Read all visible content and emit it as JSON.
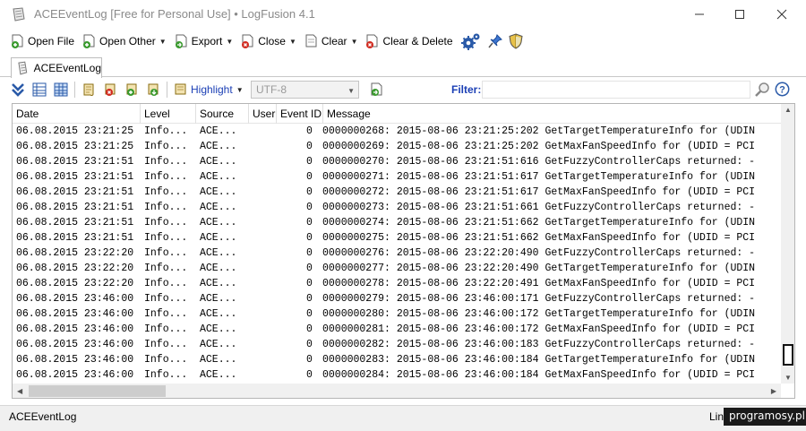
{
  "window": {
    "title": "ACEEventLog [Free for Personal Use] • LogFusion 4.1"
  },
  "toolbar": {
    "open_file": "Open File",
    "open_other": "Open Other",
    "export": "Export",
    "close": "Close",
    "clear": "Clear",
    "clear_delete": "Clear & Delete"
  },
  "tab": {
    "label": "ACEEventLog"
  },
  "toolbar2": {
    "highlight": "Highlight",
    "encoding": "UTF-8",
    "filter_label": "Filter:",
    "filter_value": ""
  },
  "grid": {
    "columns": [
      "Date",
      "Level",
      "Source",
      "User",
      "Event ID",
      "Message"
    ],
    "rows": [
      [
        "06.08.2015 23:21:25",
        "Info...",
        "ACE...",
        "",
        "0",
        "0000000268: 2015-08-06 23:21:25:202     GetTargetTemperatureInfo for (UDIN"
      ],
      [
        "06.08.2015 23:21:25",
        "Info...",
        "ACE...",
        "",
        "0",
        "0000000269: 2015-08-06 23:21:25:202     GetMaxFanSpeedInfo for (UDID = PCI"
      ],
      [
        "06.08.2015 23:21:51",
        "Info...",
        "ACE...",
        "",
        "0",
        "0000000270: 2015-08-06 23:21:51:616     GetFuzzyControllerCaps returned: -"
      ],
      [
        "06.08.2015 23:21:51",
        "Info...",
        "ACE...",
        "",
        "0",
        "0000000271: 2015-08-06 23:21:51:617     GetTargetTemperatureInfo for (UDIN"
      ],
      [
        "06.08.2015 23:21:51",
        "Info...",
        "ACE...",
        "",
        "0",
        "0000000272: 2015-08-06 23:21:51:617     GetMaxFanSpeedInfo for (UDID = PCI"
      ],
      [
        "06.08.2015 23:21:51",
        "Info...",
        "ACE...",
        "",
        "0",
        "0000000273: 2015-08-06 23:21:51:661     GetFuzzyControllerCaps returned: -"
      ],
      [
        "06.08.2015 23:21:51",
        "Info...",
        "ACE...",
        "",
        "0",
        "0000000274: 2015-08-06 23:21:51:662     GetTargetTemperatureInfo for (UDIN"
      ],
      [
        "06.08.2015 23:21:51",
        "Info...",
        "ACE...",
        "",
        "0",
        "0000000275: 2015-08-06 23:21:51:662     GetMaxFanSpeedInfo for (UDID = PCI"
      ],
      [
        "06.08.2015 23:22:20",
        "Info...",
        "ACE...",
        "",
        "0",
        "0000000276: 2015-08-06 23:22:20:490     GetFuzzyControllerCaps returned: -"
      ],
      [
        "06.08.2015 23:22:20",
        "Info...",
        "ACE...",
        "",
        "0",
        "0000000277: 2015-08-06 23:22:20:490     GetTargetTemperatureInfo for (UDIN"
      ],
      [
        "06.08.2015 23:22:20",
        "Info...",
        "ACE...",
        "",
        "0",
        "0000000278: 2015-08-06 23:22:20:491     GetMaxFanSpeedInfo for (UDID = PCI"
      ],
      [
        "06.08.2015 23:46:00",
        "Info...",
        "ACE...",
        "",
        "0",
        "0000000279: 2015-08-06 23:46:00:171     GetFuzzyControllerCaps returned: -"
      ],
      [
        "06.08.2015 23:46:00",
        "Info...",
        "ACE...",
        "",
        "0",
        "0000000280: 2015-08-06 23:46:00:172     GetTargetTemperatureInfo for (UDIN"
      ],
      [
        "06.08.2015 23:46:00",
        "Info...",
        "ACE...",
        "",
        "0",
        "0000000281: 2015-08-06 23:46:00:172     GetMaxFanSpeedInfo for (UDID = PCI"
      ],
      [
        "06.08.2015 23:46:00",
        "Info...",
        "ACE...",
        "",
        "0",
        "0000000282: 2015-08-06 23:46:00:183     GetFuzzyControllerCaps returned: -"
      ],
      [
        "06.08.2015 23:46:00",
        "Info...",
        "ACE...",
        "",
        "0",
        "0000000283: 2015-08-06 23:46:00:184     GetTargetTemperatureInfo for (UDIN"
      ],
      [
        "06.08.2015 23:46:00",
        "Info...",
        "ACE...",
        "",
        "0",
        "0000000284: 2015-08-06 23:46:00:184     GetMaxFanSpeedInfo for (UDID = PCI"
      ]
    ]
  },
  "statusbar": {
    "left": "ACEEventLog",
    "right": "Lin",
    "watermark": "programosy.pl"
  },
  "colors": {
    "accent_blue": "#1b3fb5",
    "icon_green": "#3a9a2e",
    "icon_red": "#d12a1f",
    "icon_gold": "#e0b23c"
  }
}
